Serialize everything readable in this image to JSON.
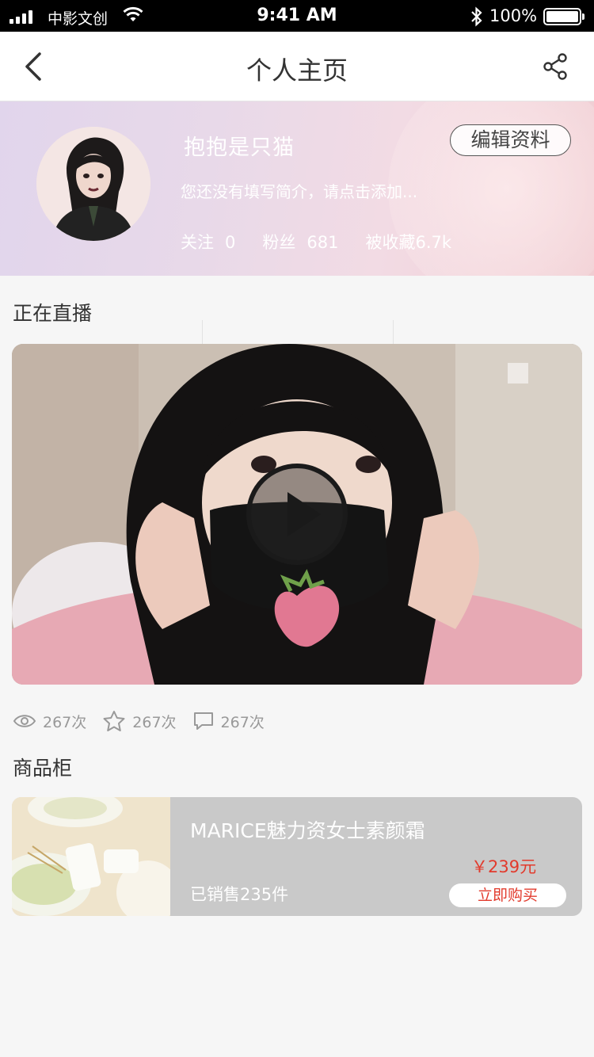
{
  "status_bar": {
    "carrier": "中影文创",
    "time": "9:41 AM",
    "battery": "100%"
  },
  "nav": {
    "title": "个人主页"
  },
  "profile": {
    "name": "抱抱是只猫",
    "edit_label": "编辑资料",
    "bio": "您还没有填写简介，请点击添加...",
    "stats": {
      "following_label": "关注",
      "following_value": "0",
      "fans_label": "粉丝",
      "fans_value": "681",
      "favorited_label": "被收藏",
      "favorited_value": "6.7k"
    }
  },
  "live": {
    "section_title": "正在直播",
    "views": "267次",
    "likes": "267次",
    "comments": "267次"
  },
  "shop": {
    "section_title": "商品柜",
    "product": {
      "name": "MARICE魅力资女士素颜霜",
      "sold": "已销售235件",
      "price": "￥239元",
      "buy_label": "立即购买"
    }
  },
  "colors": {
    "price_red": "#e23a2c",
    "page_bg": "#f6f6f6",
    "profile_gradient_start": "#e1d5ec",
    "profile_gradient_end": "#f0cdd2"
  },
  "icons": [
    "back-icon",
    "share-icon",
    "wifi-icon",
    "bluetooth-icon",
    "play-icon",
    "eye-icon",
    "star-icon",
    "comment-icon"
  ]
}
